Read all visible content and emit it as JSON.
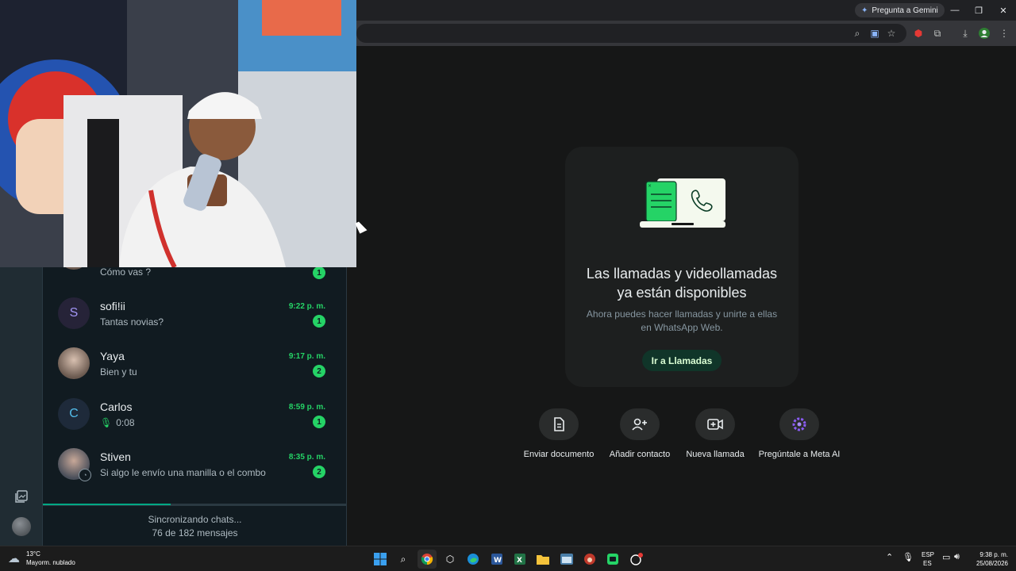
{
  "browser": {
    "gemini_button": "Pregunta a Gemini",
    "toolbar_icons": [
      "zoom-icon",
      "translate-icon",
      "star-icon",
      "shield-icon",
      "extensions-icon",
      "download-icon",
      "profile-icon",
      "menu-icon"
    ]
  },
  "chats": [
    {
      "name": "",
      "preview": "Cómo vas ?",
      "time": "",
      "unread": "1",
      "avatar": "photo"
    },
    {
      "name": "sofi!ii",
      "preview": "Tantas novias?",
      "time": "9:22 p. m.",
      "unread": "1",
      "avatar_letter": "S"
    },
    {
      "name": "Yaya",
      "preview": "Bien y tu",
      "time": "9:17 p. m.",
      "unread": "2",
      "avatar": "photo"
    },
    {
      "name": "Carlos",
      "preview": "0:08",
      "time": "8:59 p. m.",
      "unread": "1",
      "avatar_letter": "C",
      "preview_icon": "mic-icon"
    },
    {
      "name": "Stiven",
      "preview": "Si algo le envío una manilla o el combo",
      "time": "8:35 p. m.",
      "unread": "2",
      "avatar": "photo"
    }
  ],
  "sync": {
    "title": "Sincronizando chats...",
    "subtitle": "76 de 182 mensajes",
    "progress": 0.42
  },
  "calls_card": {
    "title_line1": "Las llamadas y videollamadas",
    "title_line2": "ya están disponibles",
    "subtitle": "Ahora puedes hacer llamadas y unirte a ellas en WhatsApp Web.",
    "button": "Ir a Llamadas"
  },
  "actions": [
    {
      "label": "Enviar documento",
      "icon": "document-icon"
    },
    {
      "label": "Añadir contacto",
      "icon": "add-contact-icon"
    },
    {
      "label": "Nueva llamada",
      "icon": "video-call-icon"
    },
    {
      "label": "Pregúntale a Meta AI",
      "icon": "meta-ai-icon"
    }
  ],
  "taskbar": {
    "weather_temp": "13°C",
    "weather_desc": "Mayorm. nublado",
    "lang_line1": "ESP",
    "lang_line2": "ES",
    "time": "9:38 p. m.",
    "date": "25/08/2026"
  },
  "colors": {
    "accent": "#25d366",
    "button_bg": "#103529",
    "panel_bg": "#111b21"
  }
}
